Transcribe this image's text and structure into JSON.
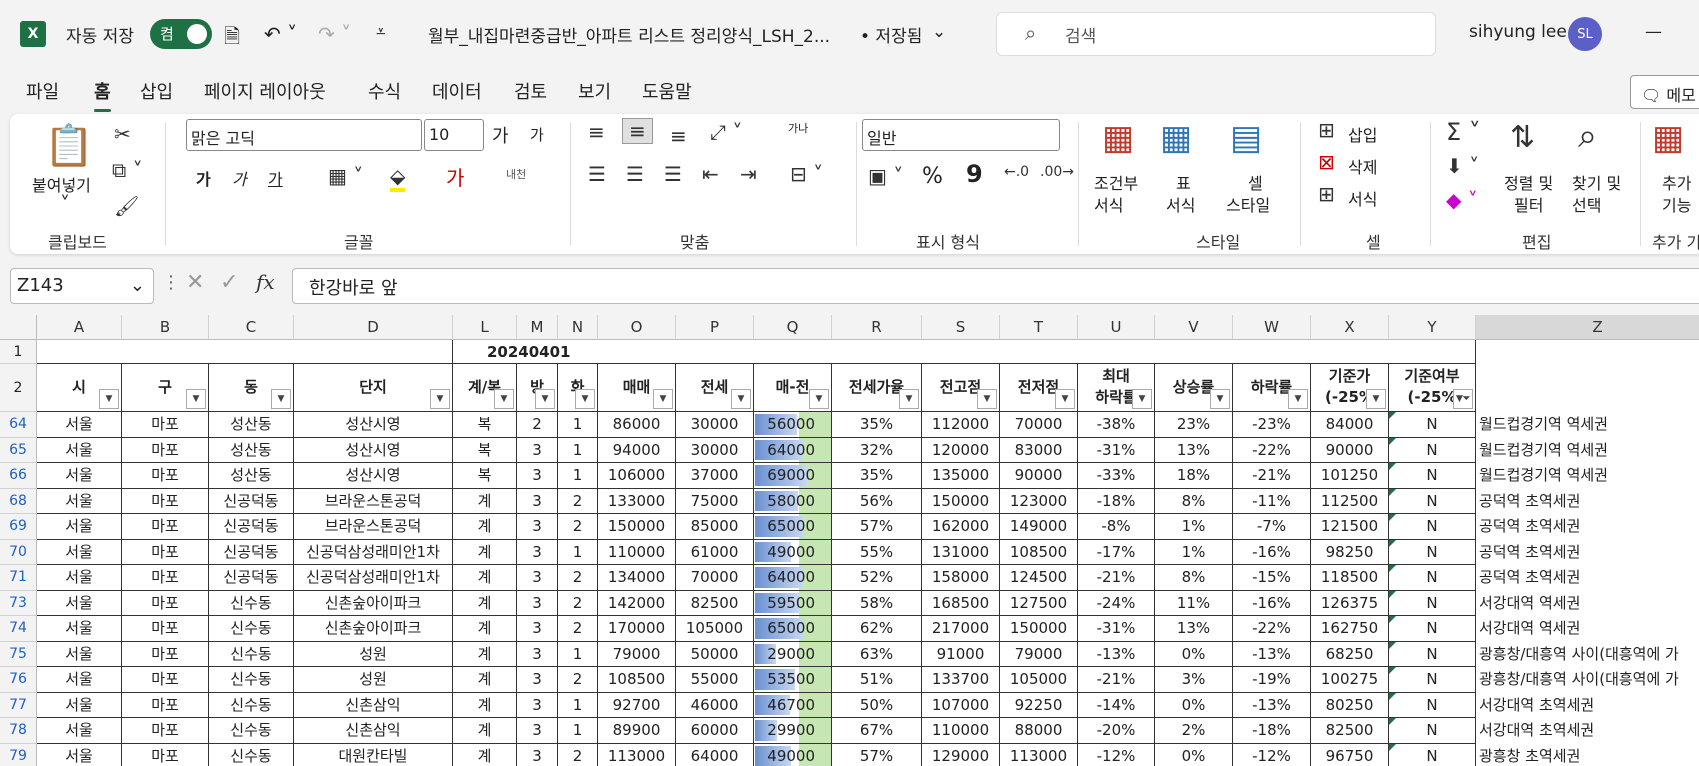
{
  "titlebar": {
    "app_logo": "X",
    "autosave_label": "자동 저장",
    "autosave_state": "켬",
    "filename": "월부_내집마련중급반_아파트 리스트 정리양식_LSH_2...",
    "saved_label": "• 저장됨",
    "search_placeholder": "검색",
    "user_name": "sihyung lee",
    "user_initials": "SL"
  },
  "menu": {
    "items": [
      "파일",
      "홈",
      "삽입",
      "페이지 레이아웃",
      "수식",
      "데이터",
      "검토",
      "보기",
      "도움말"
    ],
    "active": "홈",
    "memo": "메모"
  },
  "ribbon": {
    "clipboard": {
      "paste": "붙여넣기",
      "label": "클립보드"
    },
    "font": {
      "font_name": "맑은 고딕",
      "font_size": "10",
      "bold": "가",
      "italic": "가",
      "underline": "가",
      "inc": "가",
      "dec": "가",
      "phonetic": "내천",
      "label": "글꼴"
    },
    "align": {
      "wrap": "가나",
      "label": "맞춤"
    },
    "number": {
      "format": "일반",
      "percent": "%",
      "comma": "9",
      "label": "표시 형식"
    },
    "styles": {
      "cond": [
        "조건부",
        "서식"
      ],
      "table": [
        "표",
        "서식"
      ],
      "cell": [
        "셀",
        "스타일"
      ],
      "label": "스타일"
    },
    "cells": {
      "insert": "삽입",
      "delete": "삭제",
      "format": "서식",
      "label": "셀"
    },
    "editing": {
      "sort": [
        "정렬 및",
        "필터"
      ],
      "find": [
        "찾기 및",
        "선택"
      ],
      "label": "편집"
    },
    "addins": {
      "label": [
        "추가",
        "기능"
      ],
      "group": "추가 기"
    }
  },
  "formula": {
    "cell_ref": "Z143",
    "content": "한강바로 앞"
  },
  "columns": [
    "A",
    "B",
    "C",
    "D",
    "L",
    "M",
    "N",
    "O",
    "P",
    "Q",
    "R",
    "S",
    "T",
    "U",
    "V",
    "W",
    "X",
    "Y",
    "Z"
  ],
  "row1": {
    "rownum": "1",
    "date": "20240401"
  },
  "headers": {
    "rownum": "2",
    "cells": [
      "시",
      "구",
      "동",
      "단지",
      "계/복",
      "방",
      "화",
      "매매",
      "전세",
      "매-전",
      "전세가율",
      "전고점",
      "전저점",
      "최대\n하락률",
      "상승률",
      "하락률",
      "기준가\n(-25%",
      "기준여부\n(-25%"
    ]
  },
  "rows": [
    {
      "n": "64",
      "c": [
        "서울",
        "마포",
        "성산동",
        "성산시영",
        "복",
        "2",
        "1",
        "86000",
        "30000",
        "56000",
        "35%",
        "112000",
        "70000",
        "-38%",
        "23%",
        "-23%",
        "84000",
        "N",
        "월드컵경기역 역세권"
      ],
      "bar": 0.55
    },
    {
      "n": "65",
      "c": [
        "서울",
        "마포",
        "성산동",
        "성산시영",
        "복",
        "3",
        "1",
        "94000",
        "30000",
        "64000",
        "32%",
        "120000",
        "83000",
        "-31%",
        "13%",
        "-22%",
        "90000",
        "N",
        "월드컵경기역 역세권"
      ],
      "bar": 0.63
    },
    {
      "n": "66",
      "c": [
        "서울",
        "마포",
        "성산동",
        "성산시영",
        "복",
        "3",
        "1",
        "106000",
        "37000",
        "69000",
        "35%",
        "135000",
        "90000",
        "-33%",
        "18%",
        "-21%",
        "101250",
        "N",
        "월드컵경기역 역세권"
      ],
      "bar": 0.68
    },
    {
      "n": "68",
      "c": [
        "서울",
        "마포",
        "신공덕동",
        "브라운스톤공덕",
        "계",
        "3",
        "2",
        "133000",
        "75000",
        "58000",
        "56%",
        "150000",
        "123000",
        "-18%",
        "8%",
        "-11%",
        "112500",
        "N",
        "공덕역 초역세권"
      ],
      "bar": 0.57
    },
    {
      "n": "69",
      "c": [
        "서울",
        "마포",
        "신공덕동",
        "브라운스톤공덕",
        "계",
        "3",
        "2",
        "150000",
        "85000",
        "65000",
        "57%",
        "162000",
        "149000",
        "-8%",
        "1%",
        "-7%",
        "121500",
        "N",
        "공덕역 초역세권"
      ],
      "bar": 0.64
    },
    {
      "n": "70",
      "c": [
        "서울",
        "마포",
        "신공덕동",
        "신공덕삼성래미안1차",
        "계",
        "3",
        "1",
        "110000",
        "61000",
        "49000",
        "55%",
        "131000",
        "108500",
        "-17%",
        "1%",
        "-16%",
        "98250",
        "N",
        "공덕역 초역세권"
      ],
      "bar": 0.48
    },
    {
      "n": "71",
      "c": [
        "서울",
        "마포",
        "신공덕동",
        "신공덕삼성래미안1차",
        "계",
        "3",
        "2",
        "134000",
        "70000",
        "64000",
        "52%",
        "158000",
        "124500",
        "-21%",
        "8%",
        "-15%",
        "118500",
        "N",
        "공덕역 초역세권"
      ],
      "bar": 0.63
    },
    {
      "n": "73",
      "c": [
        "서울",
        "마포",
        "신수동",
        "신촌숲아이파크",
        "계",
        "3",
        "2",
        "142000",
        "82500",
        "59500",
        "58%",
        "168500",
        "127500",
        "-24%",
        "11%",
        "-16%",
        "126375",
        "N",
        "서강대역 역세권"
      ],
      "bar": 0.58
    },
    {
      "n": "74",
      "c": [
        "서울",
        "마포",
        "신수동",
        "신촌숲아이파크",
        "계",
        "3",
        "2",
        "170000",
        "105000",
        "65000",
        "62%",
        "217000",
        "150000",
        "-31%",
        "13%",
        "-22%",
        "162750",
        "N",
        "서강대역 역세권"
      ],
      "bar": 0.64
    },
    {
      "n": "75",
      "c": [
        "서울",
        "마포",
        "신수동",
        "성원",
        "계",
        "3",
        "1",
        "79000",
        "50000",
        "29000",
        "63%",
        "91000",
        "79000",
        "-13%",
        "0%",
        "-13%",
        "68250",
        "N",
        "광흥창/대흥역 사이(대흥역에 가"
      ],
      "bar": 0.28
    },
    {
      "n": "76",
      "c": [
        "서울",
        "마포",
        "신수동",
        "성원",
        "계",
        "3",
        "2",
        "108500",
        "55000",
        "53500",
        "51%",
        "133700",
        "105000",
        "-21%",
        "3%",
        "-19%",
        "100275",
        "N",
        "광흥창/대흥역 사이(대흥역에 가"
      ],
      "bar": 0.52
    },
    {
      "n": "77",
      "c": [
        "서울",
        "마포",
        "신수동",
        "신촌삼익",
        "계",
        "3",
        "1",
        "92700",
        "46000",
        "46700",
        "50%",
        "107000",
        "92250",
        "-14%",
        "0%",
        "-13%",
        "80250",
        "N",
        "서강대역 초역세권"
      ],
      "bar": 0.46
    },
    {
      "n": "78",
      "c": [
        "서울",
        "마포",
        "신수동",
        "신촌삼익",
        "계",
        "3",
        "1",
        "89900",
        "60000",
        "29900",
        "67%",
        "110000",
        "88000",
        "-20%",
        "2%",
        "-18%",
        "82500",
        "N",
        "서강대역 초역세권"
      ],
      "bar": 0.29
    },
    {
      "n": "79",
      "c": [
        "서울",
        "마포",
        "신수동",
        "대원칸타빌",
        "계",
        "3",
        "2",
        "113000",
        "64000",
        "49000",
        "57%",
        "129000",
        "113000",
        "-12%",
        "0%",
        "-12%",
        "96750",
        "N",
        "광흥창 초역세권"
      ],
      "bar": 0.48
    }
  ]
}
